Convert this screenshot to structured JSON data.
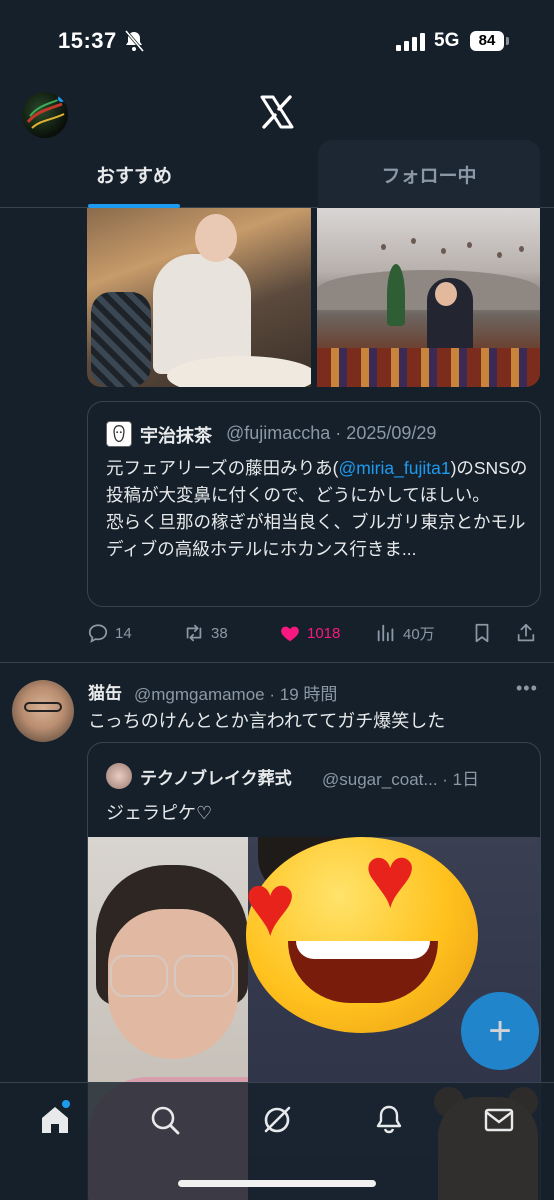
{
  "status_bar": {
    "time": "15:37",
    "network": "5G",
    "battery": "84"
  },
  "header": {
    "tabs": [
      {
        "label": "おすすめ",
        "selected": true
      },
      {
        "label": "フォロー中",
        "selected": false
      }
    ]
  },
  "post1": {
    "quote": {
      "name": "宇治抹茶",
      "handle_date": "@fujimaccha · 2025/09/29",
      "text_before": "元フェアリーズの藤田みりあ(",
      "mention": "@miria_fujita1",
      "text_after": ")のSNSの投稿が大変鼻に付くので、どうにかしてほしい。",
      "text_line2": "恐らく旦那の稼ぎが相当良く、ブルガリ東京とかモルディブの高級ホテルにホカンス行きま..."
    },
    "actions": {
      "replies": "14",
      "reposts": "38",
      "likes": "1018",
      "views": "40万"
    }
  },
  "post2": {
    "name": "猫缶",
    "handle_time": "@mgmgamamoe · 19 時間",
    "more": "•••",
    "text": "こっちのけんととか言われててガチ爆笑した",
    "quote": {
      "name": "テクノブレイク葬式",
      "handle_time": "@sugar_coat... · 1日",
      "text": "ジェラピケ♡"
    }
  },
  "fab": {
    "label": "+"
  },
  "colors": {
    "background": "#15202b",
    "accent": "#1d9bf0",
    "like": "#f91880",
    "muted": "#8b98a5",
    "border": "#38444d"
  },
  "icons": {
    "status": [
      "bell-slash-icon",
      "signal-icon"
    ],
    "header": [
      "x-logo-icon"
    ],
    "actions": [
      "reply-icon",
      "repost-icon",
      "heart-icon",
      "views-icon",
      "bookmark-icon",
      "share-icon"
    ],
    "nav": [
      "home-icon",
      "search-icon",
      "grok-icon",
      "notifications-icon",
      "messages-icon"
    ]
  }
}
